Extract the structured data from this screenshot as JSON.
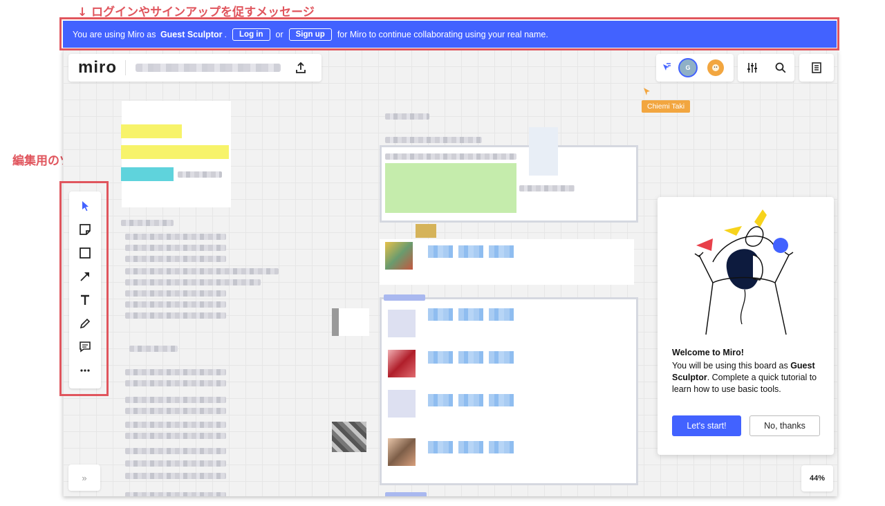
{
  "annotations": {
    "banner_note": "↓ ログインやサインアップを促すメッセージ",
    "toolbox_note": "編集用のツールボックス",
    "toolbox_arrow": "↓"
  },
  "banner": {
    "prefix": "You are using Miro as",
    "user": "Guest Sculptor",
    "period": ".",
    "login_label": "Log in",
    "or": "or",
    "signup_label": "Sign up",
    "suffix": "for Miro to continue collaborating using your real name.",
    "bg_color": "#4262ff"
  },
  "header": {
    "logo": "miro",
    "avatar_initial": "G"
  },
  "collaborator_cursor": {
    "name": "Chiemi Taki",
    "color": "#f2a640"
  },
  "toolbox": {
    "tools": [
      {
        "name": "select-tool",
        "icon": "cursor-icon"
      },
      {
        "name": "sticky-note-tool",
        "icon": "sticky-note-icon"
      },
      {
        "name": "shape-tool",
        "icon": "square-icon"
      },
      {
        "name": "arrow-tool",
        "icon": "arrow-icon"
      },
      {
        "name": "text-tool",
        "icon": "text-icon"
      },
      {
        "name": "pen-tool",
        "icon": "pen-icon"
      },
      {
        "name": "comment-tool",
        "icon": "comment-icon"
      },
      {
        "name": "more-tools",
        "icon": "more-icon"
      }
    ]
  },
  "welcome": {
    "title": "Welcome to Miro!",
    "desc_prefix": "You will be using this board as",
    "desc_user": "Guest Sculptor",
    "desc_suffix": ". Complete a quick tutorial to learn how to use basic tools.",
    "start_label": "Let's start!",
    "no_label": "No, thanks",
    "accent": "#4262ff"
  },
  "footer": {
    "zoom": "44%",
    "collapse": "»"
  }
}
